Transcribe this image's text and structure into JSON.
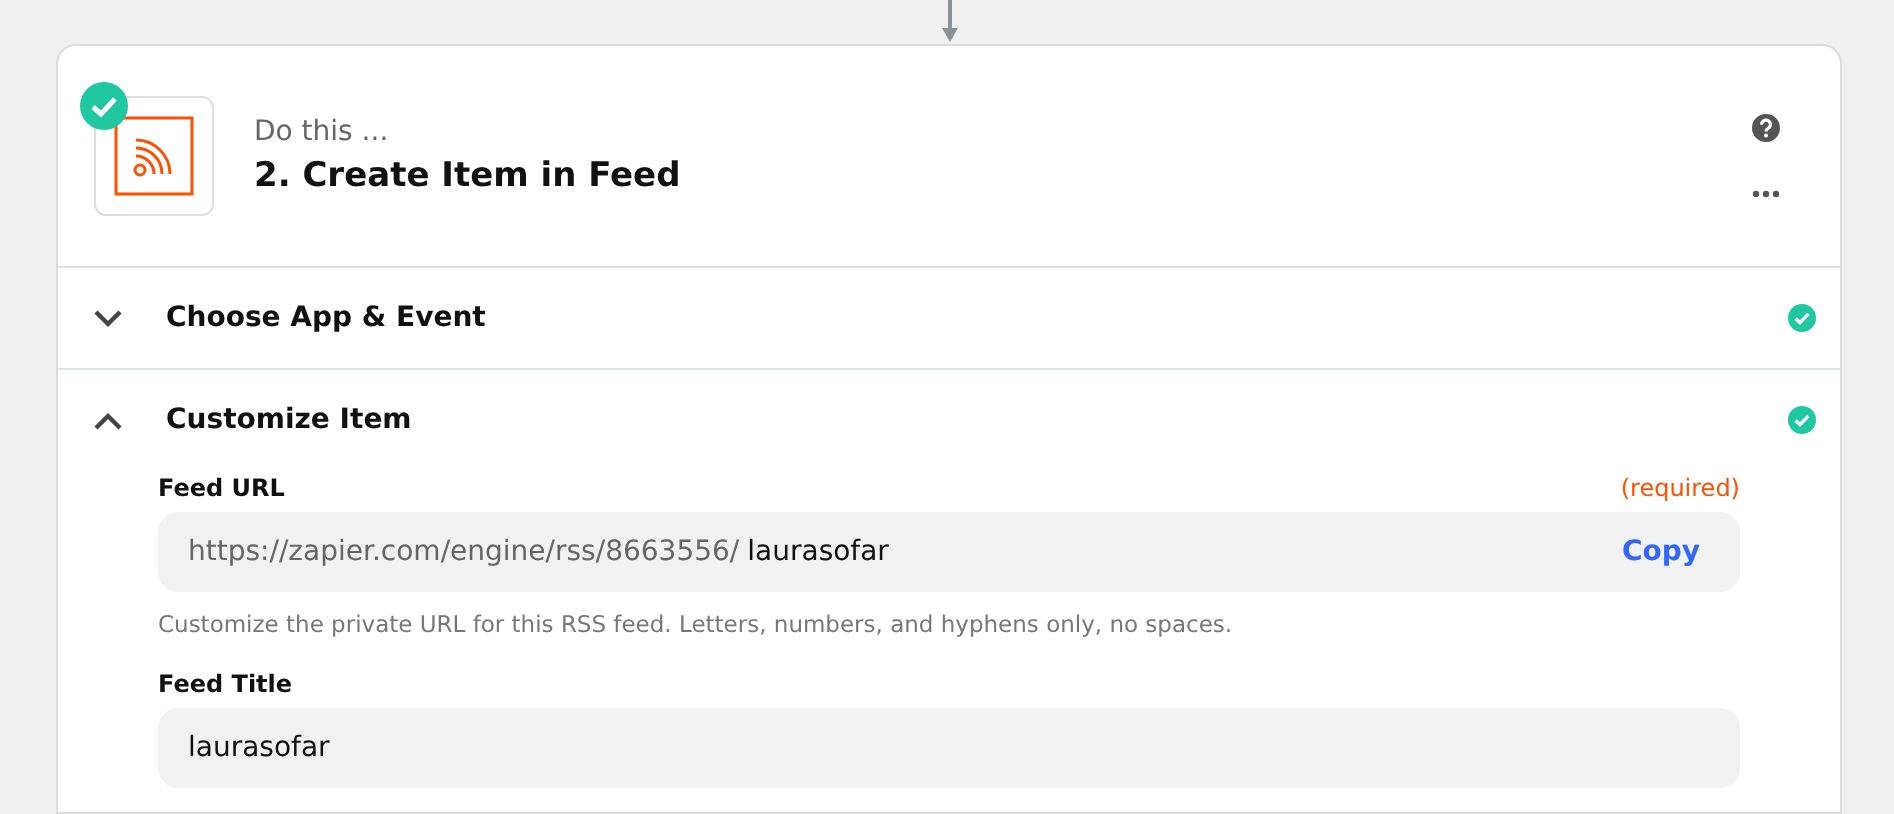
{
  "step": {
    "prefix": "Do this ...",
    "title": "2. Create Item in Feed",
    "complete": true
  },
  "sections": [
    {
      "title": "Choose App & Event",
      "expanded": false,
      "complete": true
    },
    {
      "title": "Customize Item",
      "expanded": true,
      "complete": true
    }
  ],
  "fields": [
    {
      "label": "Feed URL",
      "required": "(required)",
      "prefix": "https://zapier.com/engine/rss/8663556/",
      "value": "laurasofar",
      "action": "Copy",
      "hint": "Customize the private URL for this RSS feed. Letters, numbers, and hyphens only, no spaces."
    },
    {
      "label": "Feed Title",
      "value": "laurasofar"
    }
  ]
}
